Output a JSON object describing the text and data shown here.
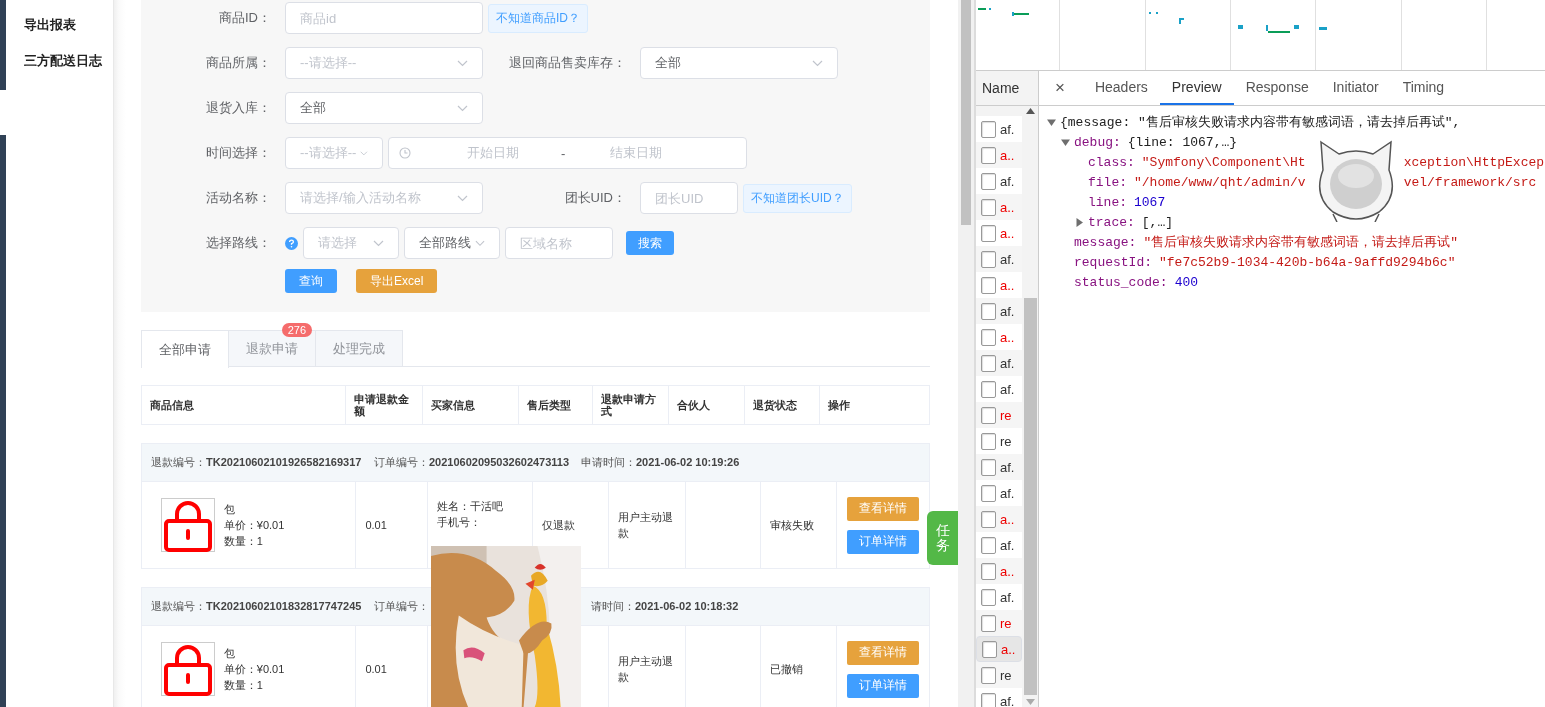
{
  "sidebar": {
    "items": [
      {
        "label": "导出报表"
      },
      {
        "label": "三方配送日志"
      }
    ]
  },
  "filter_form": {
    "rows": [
      {
        "groups": [
          {
            "label": "商品ID：",
            "controls": [
              {
                "kind": "input",
                "placeholder": "商品id"
              },
              {
                "kind": "link",
                "label": "不知道商品ID？"
              }
            ]
          }
        ]
      },
      {
        "groups": [
          {
            "label": "商品所属：",
            "controls": [
              {
                "kind": "select",
                "placeholder": "--请选择--"
              }
            ]
          },
          {
            "label": "退回商品售卖库存：",
            "controls": [
              {
                "kind": "select",
                "value": "全部"
              }
            ]
          }
        ]
      },
      {
        "groups": [
          {
            "label": "退货入库：",
            "controls": [
              {
                "kind": "select",
                "value": "全部"
              }
            ]
          }
        ]
      },
      {
        "groups": [
          {
            "label": "时间选择：",
            "controls": [
              {
                "kind": "select",
                "placeholder": "--请选择--"
              },
              {
                "kind": "daterange",
                "start_placeholder": "开始日期",
                "separator": "-",
                "end_placeholder": "结束日期"
              }
            ]
          }
        ]
      },
      {
        "groups": [
          {
            "label": "活动名称：",
            "controls": [
              {
                "kind": "select",
                "placeholder": "请选择/输入活动名称"
              }
            ]
          },
          {
            "label": "团长UID：",
            "controls": [
              {
                "kind": "input",
                "placeholder": "团长UID"
              },
              {
                "kind": "link",
                "label": "不知道团长UID？"
              }
            ]
          }
        ]
      },
      {
        "groups": [
          {
            "label": "选择路线：",
            "controls": [
              {
                "kind": "help"
              },
              {
                "kind": "select",
                "placeholder": "请选择"
              },
              {
                "kind": "select",
                "value": "全部路线"
              },
              {
                "kind": "input",
                "placeholder": "区域名称"
              },
              {
                "kind": "button",
                "label": "搜索"
              }
            ]
          }
        ]
      },
      {
        "groups": [
          {
            "controls": [
              {
                "kind": "button",
                "label": "查询"
              },
              {
                "kind": "button",
                "label": "导出Excel"
              }
            ]
          }
        ]
      }
    ]
  },
  "tabs": [
    {
      "label": "全部申请",
      "selected": true
    },
    {
      "label": "退款申请",
      "selected": false,
      "badge": "276"
    },
    {
      "label": "处理完成",
      "selected": false
    }
  ],
  "table": {
    "columns": [
      "商品信息",
      "申请退款金额",
      "买家信息",
      "售后类型",
      "退款申请方式",
      "合伙人",
      "退货状态",
      "操作"
    ],
    "orders": [
      {
        "header": [
          {
            "label": "退款编号：",
            "value": "TK20210602101926582169317"
          },
          {
            "label": "订单编号：",
            "value": "20210602095032602473113"
          },
          {
            "label": "申请时间：",
            "value": "2021-06-02 10:19:26"
          }
        ],
        "product": {
          "name": "包",
          "price": "单价：¥0.01",
          "quantity": "数量：1"
        },
        "amount": "0.01",
        "buyer": [
          "姓名：干活吧",
          "手机号："
        ],
        "type": "仅退款",
        "method": "用户主动退款",
        "status": "审核失败",
        "actions": [
          "查看详情",
          "订单详情"
        ]
      },
      {
        "header": [
          {
            "label": "退款编号：",
            "value": "TK20210602101832817747245"
          },
          {
            "label": "订单编号："
          },
          {
            "label": "请时间：",
            "value": "2021-06-02 10:18:32"
          }
        ],
        "product": {
          "name": "包",
          "price": "单价：¥0.01",
          "quantity": "数量：1"
        },
        "amount": "0.01",
        "method": "用户主动退款",
        "status": "已撤销",
        "actions": [
          "查看详情",
          "订单详情"
        ]
      }
    ]
  },
  "task_button": {
    "label": "任务"
  },
  "devtools": {
    "name_header": "Name",
    "close": "×",
    "tabs": [
      {
        "label": "Headers",
        "selected": false
      },
      {
        "label": "Preview",
        "selected": true
      },
      {
        "label": "Response",
        "selected": false
      },
      {
        "label": "Initiator",
        "selected": false
      },
      {
        "label": "Timing",
        "selected": false
      }
    ],
    "requests": [
      {
        "name": "af.",
        "error": false,
        "selected": false
      },
      {
        "name": "a..",
        "error": true,
        "selected": false
      },
      {
        "name": "af.",
        "error": false,
        "selected": false
      },
      {
        "name": "a..",
        "error": true,
        "selected": false
      },
      {
        "name": "a..",
        "error": true,
        "selected": false
      },
      {
        "name": "af.",
        "error": false,
        "selected": false
      },
      {
        "name": "a..",
        "error": true,
        "selected": false
      },
      {
        "name": "af.",
        "error": false,
        "selected": false
      },
      {
        "name": "a..",
        "error": true,
        "selected": false
      },
      {
        "name": "af.",
        "error": false,
        "selected": false
      },
      {
        "name": "af.",
        "error": false,
        "selected": false
      },
      {
        "name": "re",
        "error": true,
        "selected": false
      },
      {
        "name": "re",
        "error": false,
        "selected": false
      },
      {
        "name": "af.",
        "error": false,
        "selected": false
      },
      {
        "name": "af.",
        "error": false,
        "selected": false
      },
      {
        "name": "a..",
        "error": true,
        "selected": false
      },
      {
        "name": "af.",
        "error": false,
        "selected": false
      },
      {
        "name": "a..",
        "error": true,
        "selected": false
      },
      {
        "name": "af.",
        "error": false,
        "selected": false
      },
      {
        "name": "re",
        "error": true,
        "selected": false
      },
      {
        "name": "a..",
        "error": true,
        "selected": true
      },
      {
        "name": "re",
        "error": false,
        "selected": false
      },
      {
        "name": "af.",
        "error": false,
        "selected": false
      }
    ],
    "preview": {
      "summary": "{message: \"售后审核失败请求内容带有敏感词语，请去掉后再试\",",
      "expanded": true,
      "children": [
        {
          "key": "debug:",
          "summary": "{line: 1067,…}",
          "expanded": true,
          "children": [
            {
              "key": "class:",
              "kind": "string",
              "parts": [
                "\"Symfony\\Component\\Ht",
                "xception\\HttpExcep"
              ]
            },
            {
              "key": "file:",
              "kind": "string",
              "parts": [
                "\"/home/www/qht/admin/v",
                "vel/framework/src"
              ]
            },
            {
              "key": "line:",
              "kind": "number",
              "parts": [
                "1067"
              ]
            },
            {
              "key": "trace:",
              "summary": "[,…]",
              "expanded": false
            }
          ]
        },
        {
          "key": "message:",
          "kind": "string",
          "parts": [
            "\"售后审核失败请求内容带有敏感词语，请去掉后再试\""
          ]
        },
        {
          "key": "requestId:",
          "kind": "string",
          "parts": [
            "\"fe7c52b9-1034-420b-b64a-9affd9294b6c\""
          ]
        },
        {
          "key": "status_code:",
          "kind": "number",
          "parts": [
            "400"
          ]
        }
      ]
    }
  }
}
